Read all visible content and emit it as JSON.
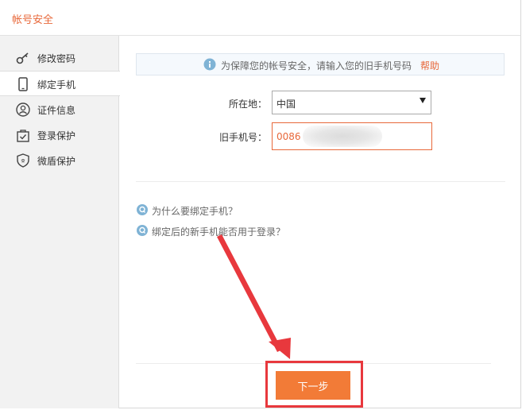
{
  "window": {
    "title": "帐号安全"
  },
  "sidebar": {
    "items": [
      {
        "label": "修改密码",
        "icon": "key-icon"
      },
      {
        "label": "绑定手机",
        "icon": "phone-icon",
        "active": true
      },
      {
        "label": "证件信息",
        "icon": "id-card-icon"
      },
      {
        "label": "登录保护",
        "icon": "login-lock-icon"
      },
      {
        "label": "微盾保护",
        "icon": "shield-icon"
      }
    ]
  },
  "notice": {
    "text": "为保障您的帐号安全，请输入您的旧手机号码",
    "help": "帮助"
  },
  "form": {
    "location_label": "所在地：",
    "location_value": "中国",
    "phone_label": "旧手机号：",
    "phone_prefix": "0086"
  },
  "faq": [
    {
      "text": "为什么要绑定手机？"
    },
    {
      "text": "绑定后的新手机能否用于登录？"
    }
  ],
  "actions": {
    "next_label": "下一步"
  },
  "colors": {
    "accent": "#e8683a",
    "button": "#f27b37",
    "highlight": "#e8383d",
    "faq_icon": "#7fb3d5"
  }
}
